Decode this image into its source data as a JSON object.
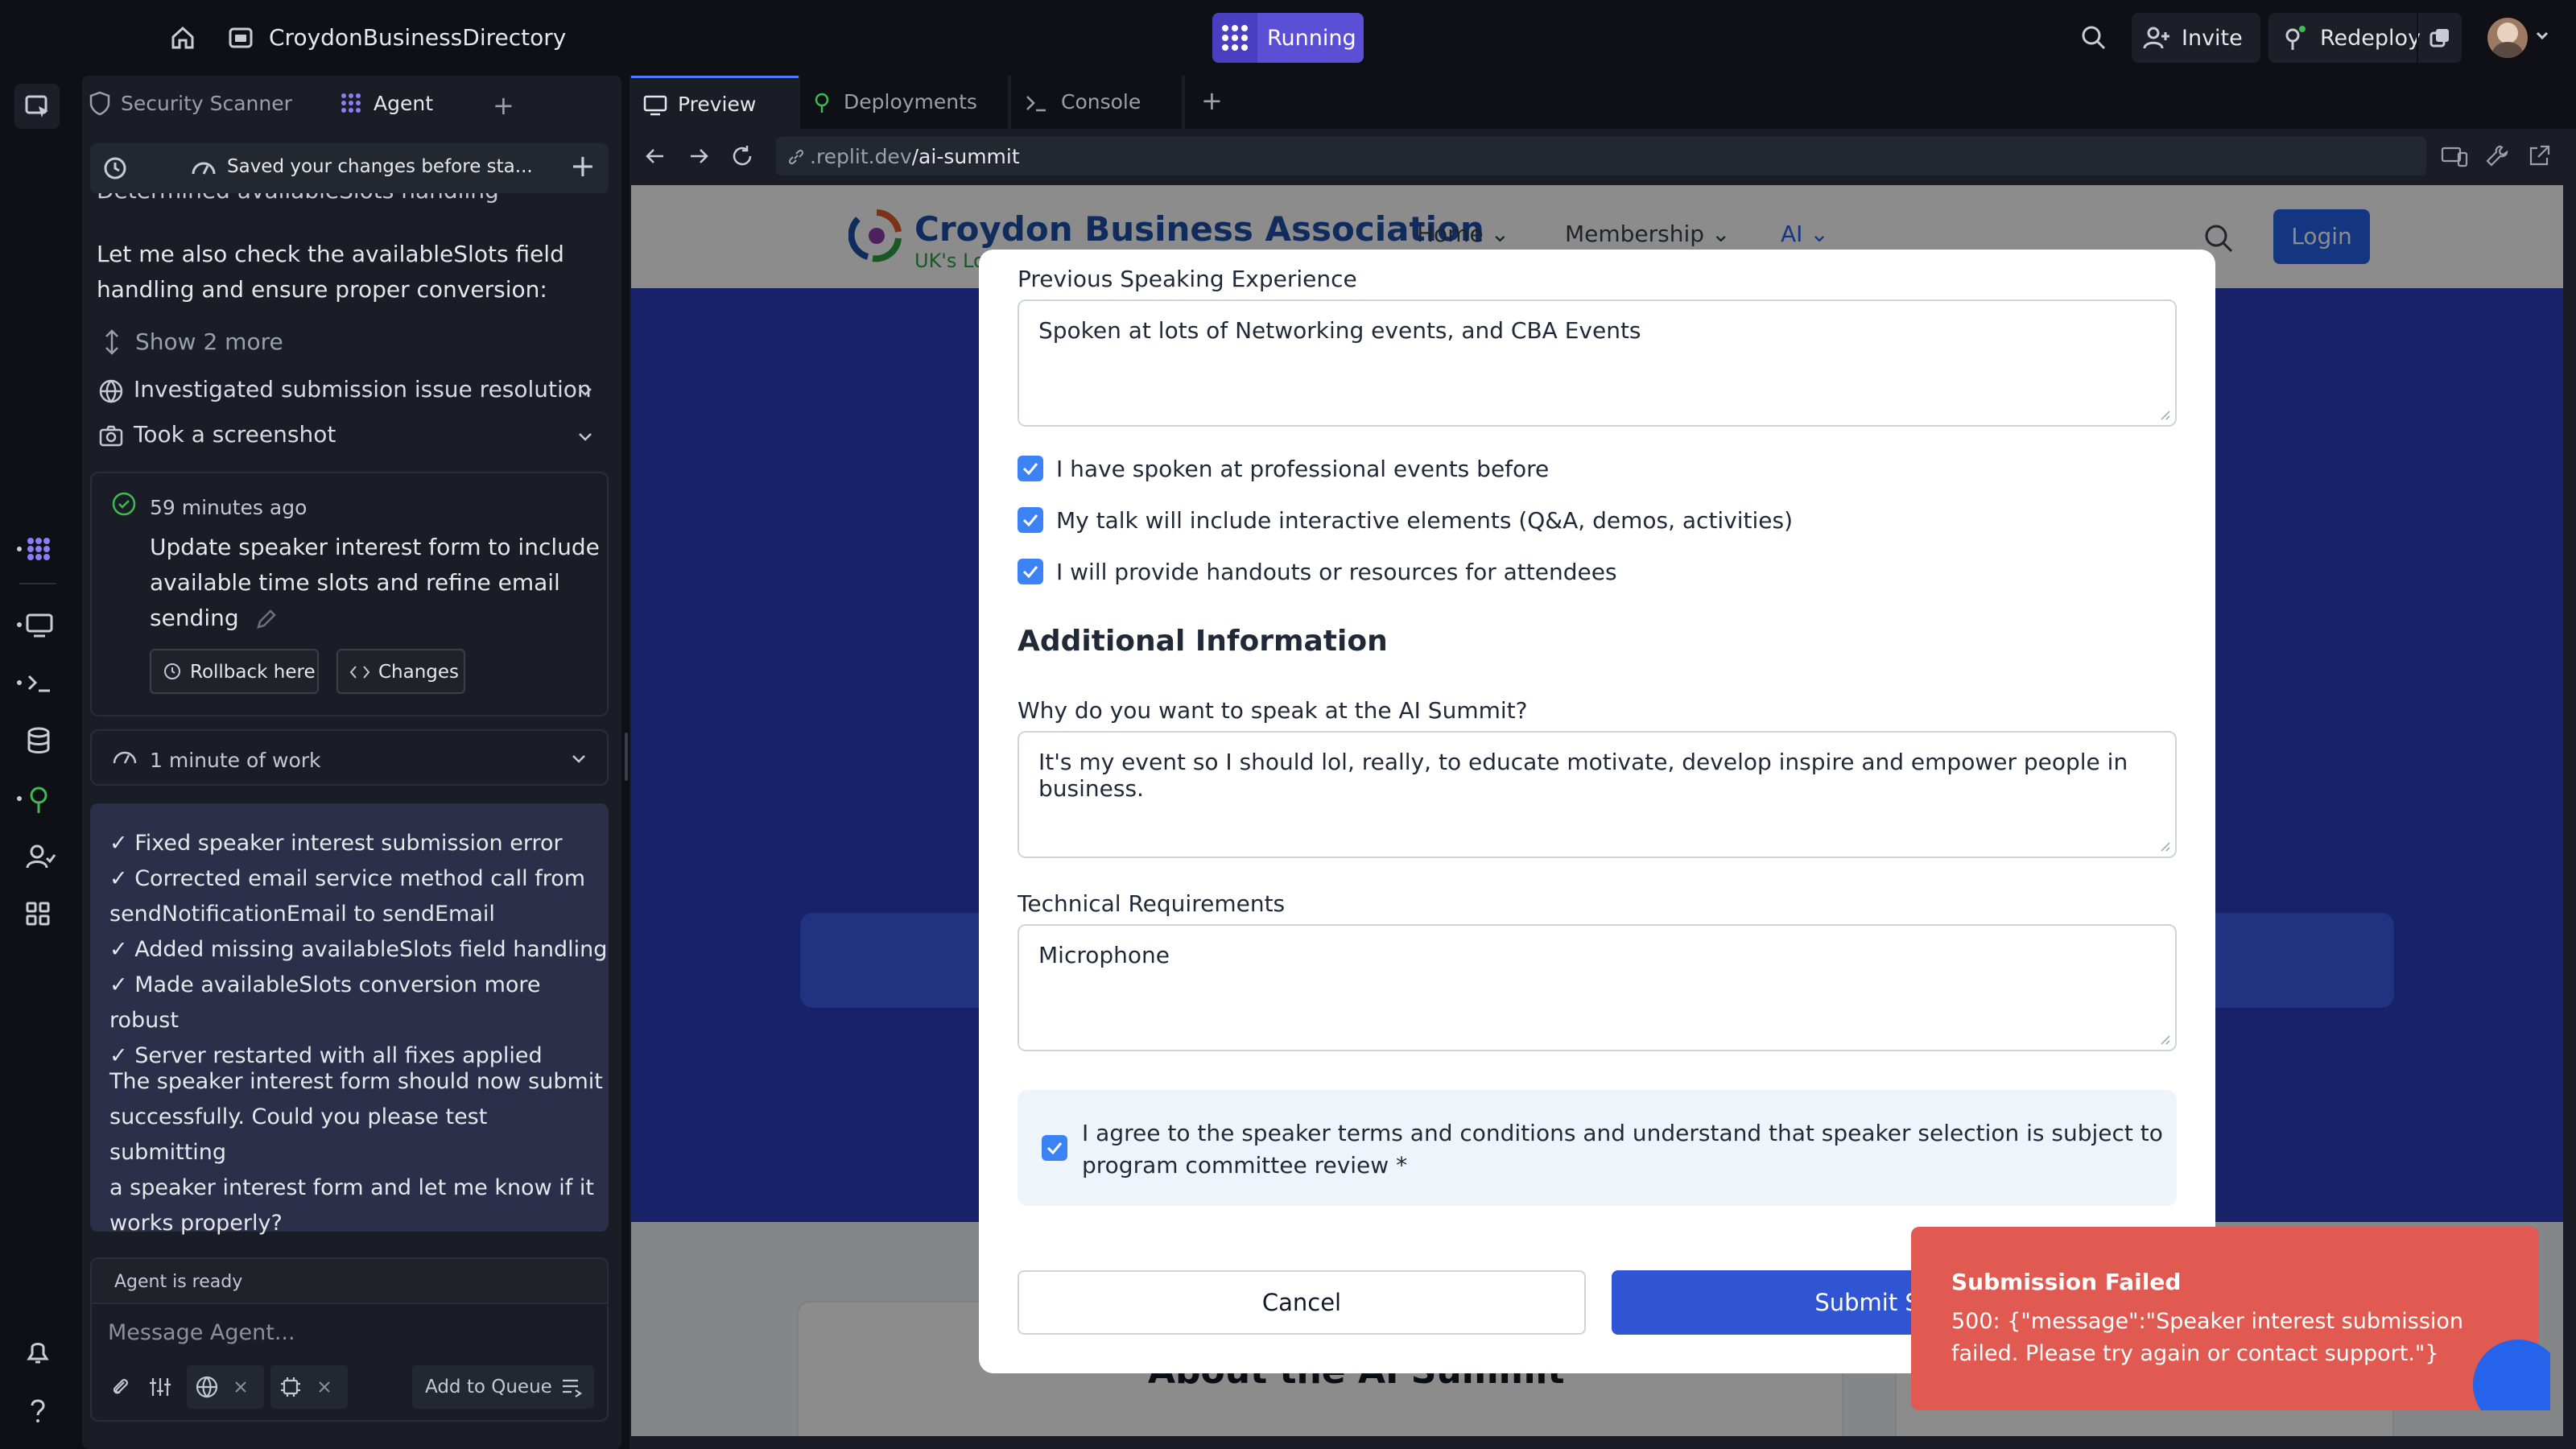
{
  "topbar": {
    "app_name": "CroydonBusinessDirectory",
    "status": "Running",
    "invite": "Invite",
    "redeploy": "Redeploy"
  },
  "left_tabs": [
    "Security Scanner",
    "Agent"
  ],
  "right_tabs": [
    "Preview",
    "Deployments",
    "Console"
  ],
  "agent": {
    "saved_msg": "Saved your changes before sta...",
    "partial_step": "Determined availableSlots handling",
    "msg1": [
      "Let me also check the availableSlots field",
      "handling and ensure proper conversion:"
    ],
    "show_more": "Show 2 more",
    "step1": "Investigated submission issue resolution",
    "step2": "Took a screenshot",
    "checkpoint": {
      "time": "59 minutes ago",
      "lines": [
        "Update speaker interest form to include",
        "available time slots and refine email",
        "sending"
      ],
      "rollback": "Rollback here",
      "changes": "Changes"
    },
    "work": "1 minute of work",
    "summary": [
      "✓ Fixed speaker interest submission error",
      "✓ Corrected email service method call from",
      "sendNotificationEmail to sendEmail",
      "✓ Added missing availableSlots field handling",
      "✓ Made availableSlots conversion more robust",
      "✓ Server restarted with all fixes applied"
    ],
    "closing": [
      "The speaker interest form should now submit",
      "successfully. Could you please test submitting",
      "a speaker interest form and let me know if it",
      "works properly?"
    ],
    "status": "Agent is ready",
    "input_placeholder": "Message Agent...",
    "queue": "Add to Queue"
  },
  "browser": {
    "url_prefix": ".replit.dev",
    "url_path": "/ai-summit"
  },
  "site": {
    "brand": "Croydon Business Association",
    "tagline": "UK's Lo",
    "nav": [
      "Home",
      "Membership",
      "AI"
    ],
    "login": "Login",
    "section_title": "About the AI Summit"
  },
  "form": {
    "prev_label": "Previous Speaking Experience",
    "prev_value": "Spoken at lots of Networking events, and CBA Events",
    "checks": [
      "I have spoken at professional events before",
      "My talk will include interactive elements (Q&A, demos, activities)",
      "I will provide handouts or resources for attendees"
    ],
    "additional_heading": "Additional Information",
    "why_label": "Why do you want to speak at the AI Summit?",
    "why_value": "It's my event so I should lol, really, to educate motivate, develop inspire and empower people in business.",
    "tech_label": "Technical Requirements",
    "tech_value": "Microphone",
    "agree_line1": "I agree to the speaker terms and conditions and understand that speaker selection is subject to",
    "agree_line2": "program committee review *",
    "cancel": "Cancel",
    "submit": "Submit Speak"
  },
  "toast": {
    "title": "Submission Failed",
    "line1": "500: {\"message\":\"Speaker interest submission",
    "line2": "failed. Please try again or contact support.\"}"
  },
  "colors": {
    "accent": "#5b4fd6",
    "submit": "#2f55d4",
    "toast": "#e05a52",
    "checkbox": "#3b82f6",
    "brand_blue": "#1e4fa8",
    "hero_blue": "#2b3fbd"
  }
}
